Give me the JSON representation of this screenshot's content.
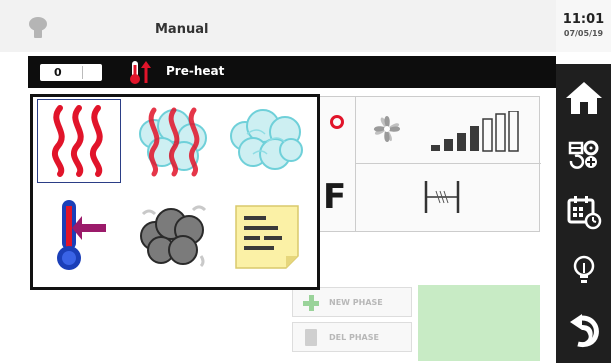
{
  "header": {
    "title": "Manual",
    "time": "11:01",
    "date": "07/05/19"
  },
  "phase_bar": {
    "counter_value": "0",
    "phase_label": "Pre-heat"
  },
  "panel": {
    "unit_label": "F"
  },
  "phase_buttons": {
    "new_phase": "NEW PHASE",
    "del_phase": "DEL PHASE"
  },
  "popup": {
    "options": [
      {
        "icon": "convection-heat-icon",
        "selected": true
      },
      {
        "icon": "combi-heat-steam-icon",
        "selected": false
      },
      {
        "icon": "steam-icon",
        "selected": false
      },
      {
        "icon": "probe-temperature-icon",
        "selected": false
      },
      {
        "icon": "smoke-icon",
        "selected": false
      },
      {
        "icon": "notes-icon",
        "selected": false
      }
    ]
  },
  "colors": {
    "heat_red": "#e1142a",
    "steam_cyan": "#6fd0d9",
    "dock_bg": "#1f1f1f",
    "phase_bar_bg": "#0d0d0d",
    "start_green": "#c8ebc5"
  },
  "dock": {
    "items": [
      "home-icon",
      "settings-tools-icon",
      "calendar-clock-icon",
      "lightbulb-icon",
      "back-arrow-icon"
    ]
  }
}
